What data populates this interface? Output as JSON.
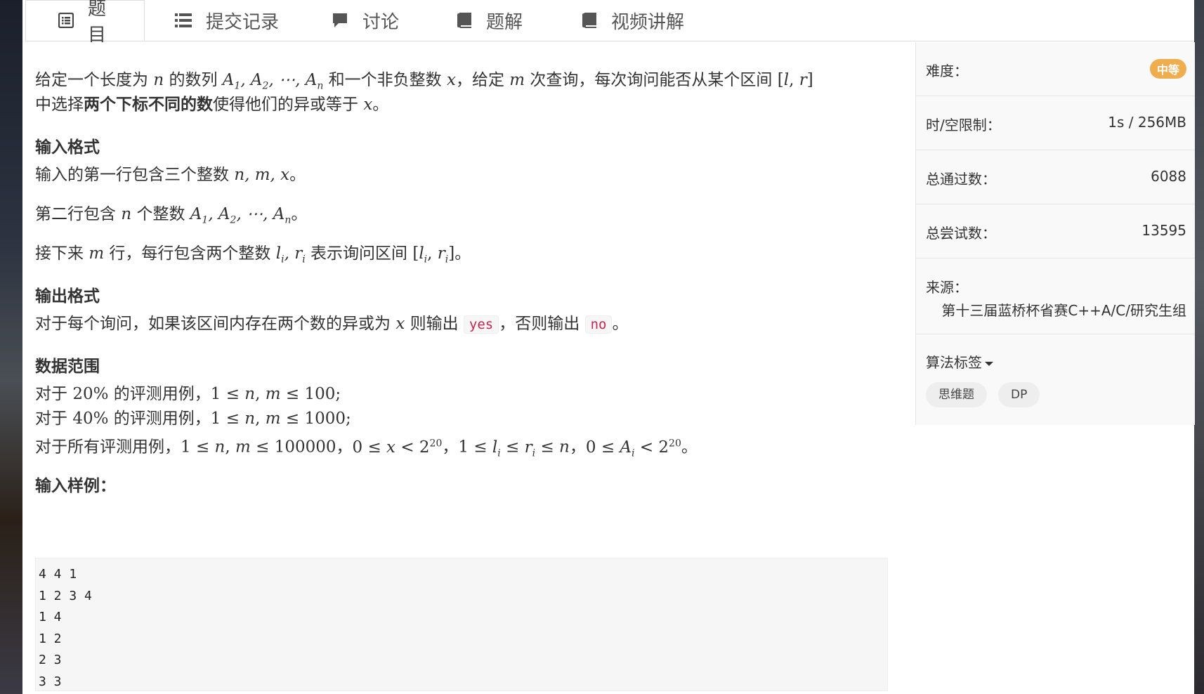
{
  "tabs": [
    {
      "label": "题目",
      "icon": "list-doc-icon"
    },
    {
      "label": "提交记录",
      "icon": "list-icon"
    },
    {
      "label": "讨论",
      "icon": "comment-icon"
    },
    {
      "label": "题解",
      "icon": "book-icon"
    },
    {
      "label": "视频讲解",
      "icon": "book-icon"
    }
  ],
  "problem": {
    "p1a": "给定一个长度为 ",
    "p1b": " 的数列 ",
    "p1c": " 和一个非负整数 ",
    "p1d": "，给定 ",
    "p1e": " 次查询，每次询问能否从某个区间 ",
    "p2a": "中选择",
    "p2bold": "两个下标不同的数",
    "p2b": "使得他们的异或等于 ",
    "p2c": "。",
    "input_heading": "输入格式",
    "in1": "输入的第一行包含三个整数 ",
    "in2a": "第二行包含 ",
    "in2b": " 个整数 ",
    "in3a": "接下来 ",
    "in3b": " 行，每行包含两个整数 ",
    "in3c": " 表示询问区间 ",
    "output_heading": "输出格式",
    "out1": "对于每个询问，如果该区间内存在两个数的异或为 ",
    "out2": " 则输出 ",
    "out_yes": "yes",
    "out3": "，否则输出 ",
    "out_no": "no",
    "out4": "。",
    "range_heading": "数据范围",
    "r1a": "对于 ",
    "r1b": " 的评测用例，",
    "r3a": "对于所有评测用例，",
    "sample_heading": "输入样例：",
    "sample_lines": [
      "4 4 1",
      "1 2 3 4",
      "1 4",
      "1 2",
      "2 3",
      "3 3"
    ]
  },
  "sidebar": {
    "difficulty_label": "难度：",
    "difficulty_value": "中等",
    "limit_label": "时/空限制：",
    "limit_value": "1s / 256MB",
    "passed_label": "总通过数：",
    "passed_value": "6088",
    "tried_label": "总尝试数：",
    "tried_value": "13595",
    "source_label": "来源：",
    "source_value": "第十三届蓝桥杯省赛C++A/C/研究生组",
    "tags_label": "算法标签",
    "tags": [
      "思维题",
      "DP"
    ]
  }
}
